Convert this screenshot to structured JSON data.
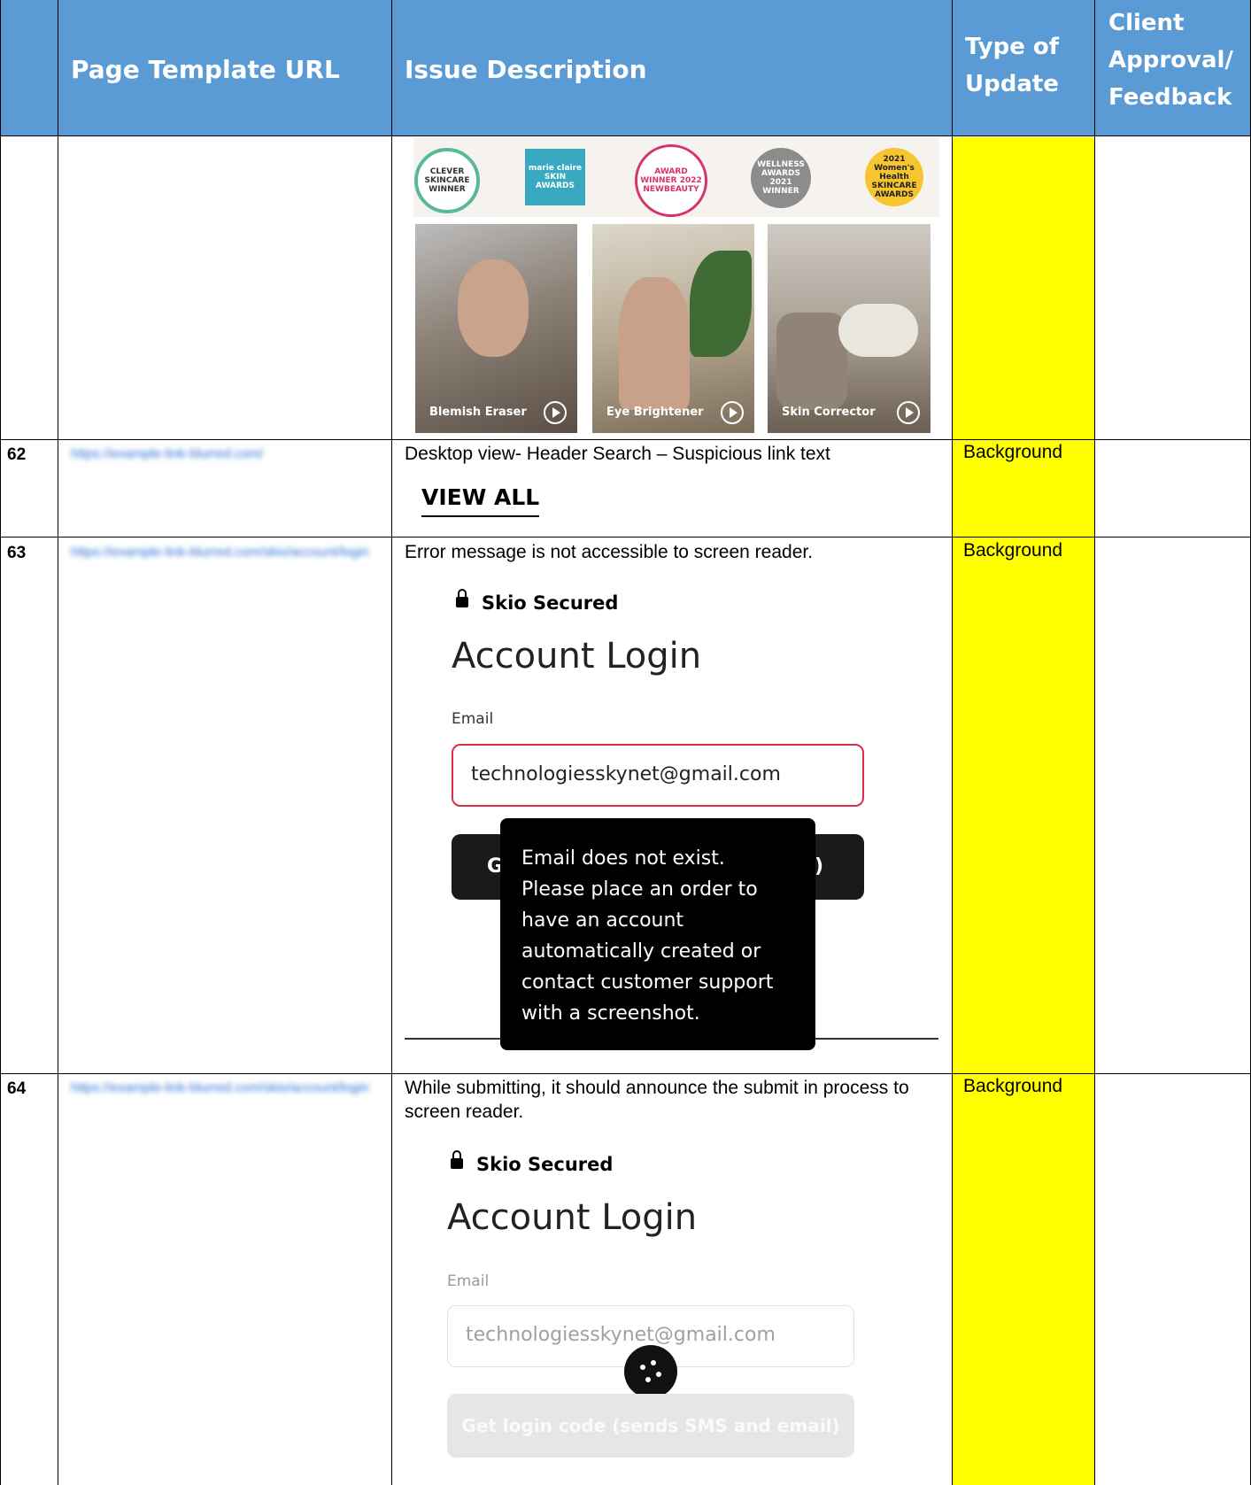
{
  "table": {
    "headers": {
      "col1": "",
      "col2": "Page Template URL",
      "col3": "Issue Description",
      "col4": "Type of Update",
      "col5": "Client Approval/ Feedback"
    },
    "awards": {
      "clever": "CLEVER SKINCARE WINNER",
      "marie": "marie claire SKIN AWARDS",
      "newbeauty": "AWARD WINNER 2022 NEWBEAUTY",
      "wellness": "WELLNESS AWARDS 2021 WINNER",
      "womens": "2021 Women's Health SKINCARE AWARDS"
    },
    "videos": [
      "Blemish Eraser",
      "Eye Brightener",
      "Skin Corrector"
    ],
    "rows": [
      {
        "num": "62",
        "url": "https://example-link-blurred.com/",
        "description": "Desktop view- Header Search – Suspicious link text",
        "type": "Background",
        "shot_text": "VIEW ALL"
      },
      {
        "num": "63",
        "url": "https://example-link-blurred.com/skio/account/login",
        "description": "Error message is not accessible to screen reader.",
        "type": "Background",
        "secured": "Skio Secured",
        "heading": "Account Login",
        "email_label": "Email",
        "email_value": "technologiesskynet@gmail.com",
        "button_partial_left": "G",
        "button_partial_right": ")",
        "tooltip": [
          "Email does not exist.",
          "Please place an order to",
          "have an account",
          "automatically created or",
          "contact customer support",
          "with a screenshot."
        ]
      },
      {
        "num": "64",
        "url": "https://example-link-blurred.com/skio/account/login",
        "description": "While submitting, it should announce the submit in process to screen reader.",
        "type": "Background",
        "secured": "Skio Secured",
        "heading": "Account Login",
        "email_label": "Email",
        "email_value": "technologiesskynet@gmail.com",
        "button_label": "Get login code (sends SMS and email)"
      }
    ]
  },
  "colors": {
    "header_bg": "#5b9bd5",
    "highlight": "#ffff00",
    "error_border": "#d6304a"
  }
}
